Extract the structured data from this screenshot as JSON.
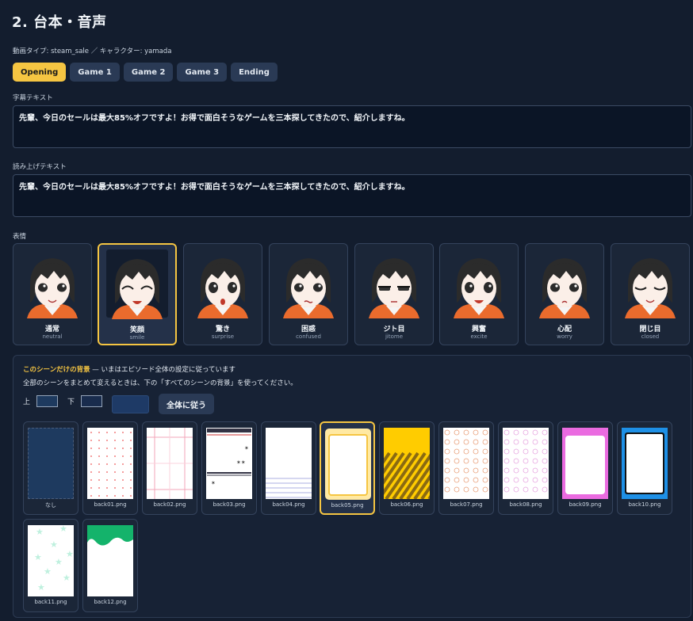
{
  "page": {
    "title": "2. 台本・音声",
    "meta": "動画タイプ: steam_sale ／ キャラクター: yamada"
  },
  "tabs": [
    {
      "label": "Opening",
      "active": true
    },
    {
      "label": "Game 1",
      "active": false
    },
    {
      "label": "Game 2",
      "active": false
    },
    {
      "label": "Game 3",
      "active": false
    },
    {
      "label": "Ending",
      "active": false
    }
  ],
  "subtitle": {
    "label": "字幕テキスト",
    "value": "先輩、今日のセールは最大85%オフですよ！お得で面白そうなゲームを三本探してきたので、紹介しますね。"
  },
  "narration": {
    "label": "読み上げテキスト",
    "value": "先輩、今日のセールは最大85%オフですよ！お得で面白そうなゲームを三本探してきたので、紹介しますね。"
  },
  "expressions": {
    "label": "表情",
    "items": [
      {
        "name": "通常",
        "id": "neutral"
      },
      {
        "name": "笑顔",
        "id": "smile"
      },
      {
        "name": "驚き",
        "id": "surprise"
      },
      {
        "name": "困惑",
        "id": "confused"
      },
      {
        "name": "ジト目",
        "id": "jitome"
      },
      {
        "name": "興奮",
        "id": "excite"
      },
      {
        "name": "心配",
        "id": "worry"
      },
      {
        "name": "閉じ目",
        "id": "closed"
      }
    ],
    "selected": "smile"
  },
  "background": {
    "heading": "このシーンだけの背景",
    "heading_rest": " — いまはエピソード全体の設定に従っています",
    "note": "全部のシーンをまとめて変えるときは、下の「すべてのシーンの背景」を使ってください。",
    "top_label": "上",
    "bottom_label": "下",
    "follow_button": "全体に従う",
    "colors": {
      "top": "#1e3a5f",
      "bottom": "#192c4d",
      "solid": "#1e3a66"
    },
    "selected": "back05.png",
    "options": [
      {
        "label": "なし",
        "pattern": "none"
      },
      {
        "label": "back01.png",
        "pattern": "dots"
      },
      {
        "label": "back02.png",
        "pattern": "grid"
      },
      {
        "label": "back03.png",
        "pattern": "comic"
      },
      {
        "label": "back04.png",
        "pattern": "lined"
      },
      {
        "label": "back05.png",
        "pattern": "yellow-frame"
      },
      {
        "label": "back06.png",
        "pattern": "stripes"
      },
      {
        "label": "back07.png",
        "pattern": "swirl-orange"
      },
      {
        "label": "back08.png",
        "pattern": "swirl-pink"
      },
      {
        "label": "back09.png",
        "pattern": "pink-frame"
      },
      {
        "label": "back10.png",
        "pattern": "blue-frame"
      },
      {
        "label": "back11.png",
        "pattern": "stars"
      },
      {
        "label": "back12.png",
        "pattern": "green-wave"
      }
    ]
  }
}
